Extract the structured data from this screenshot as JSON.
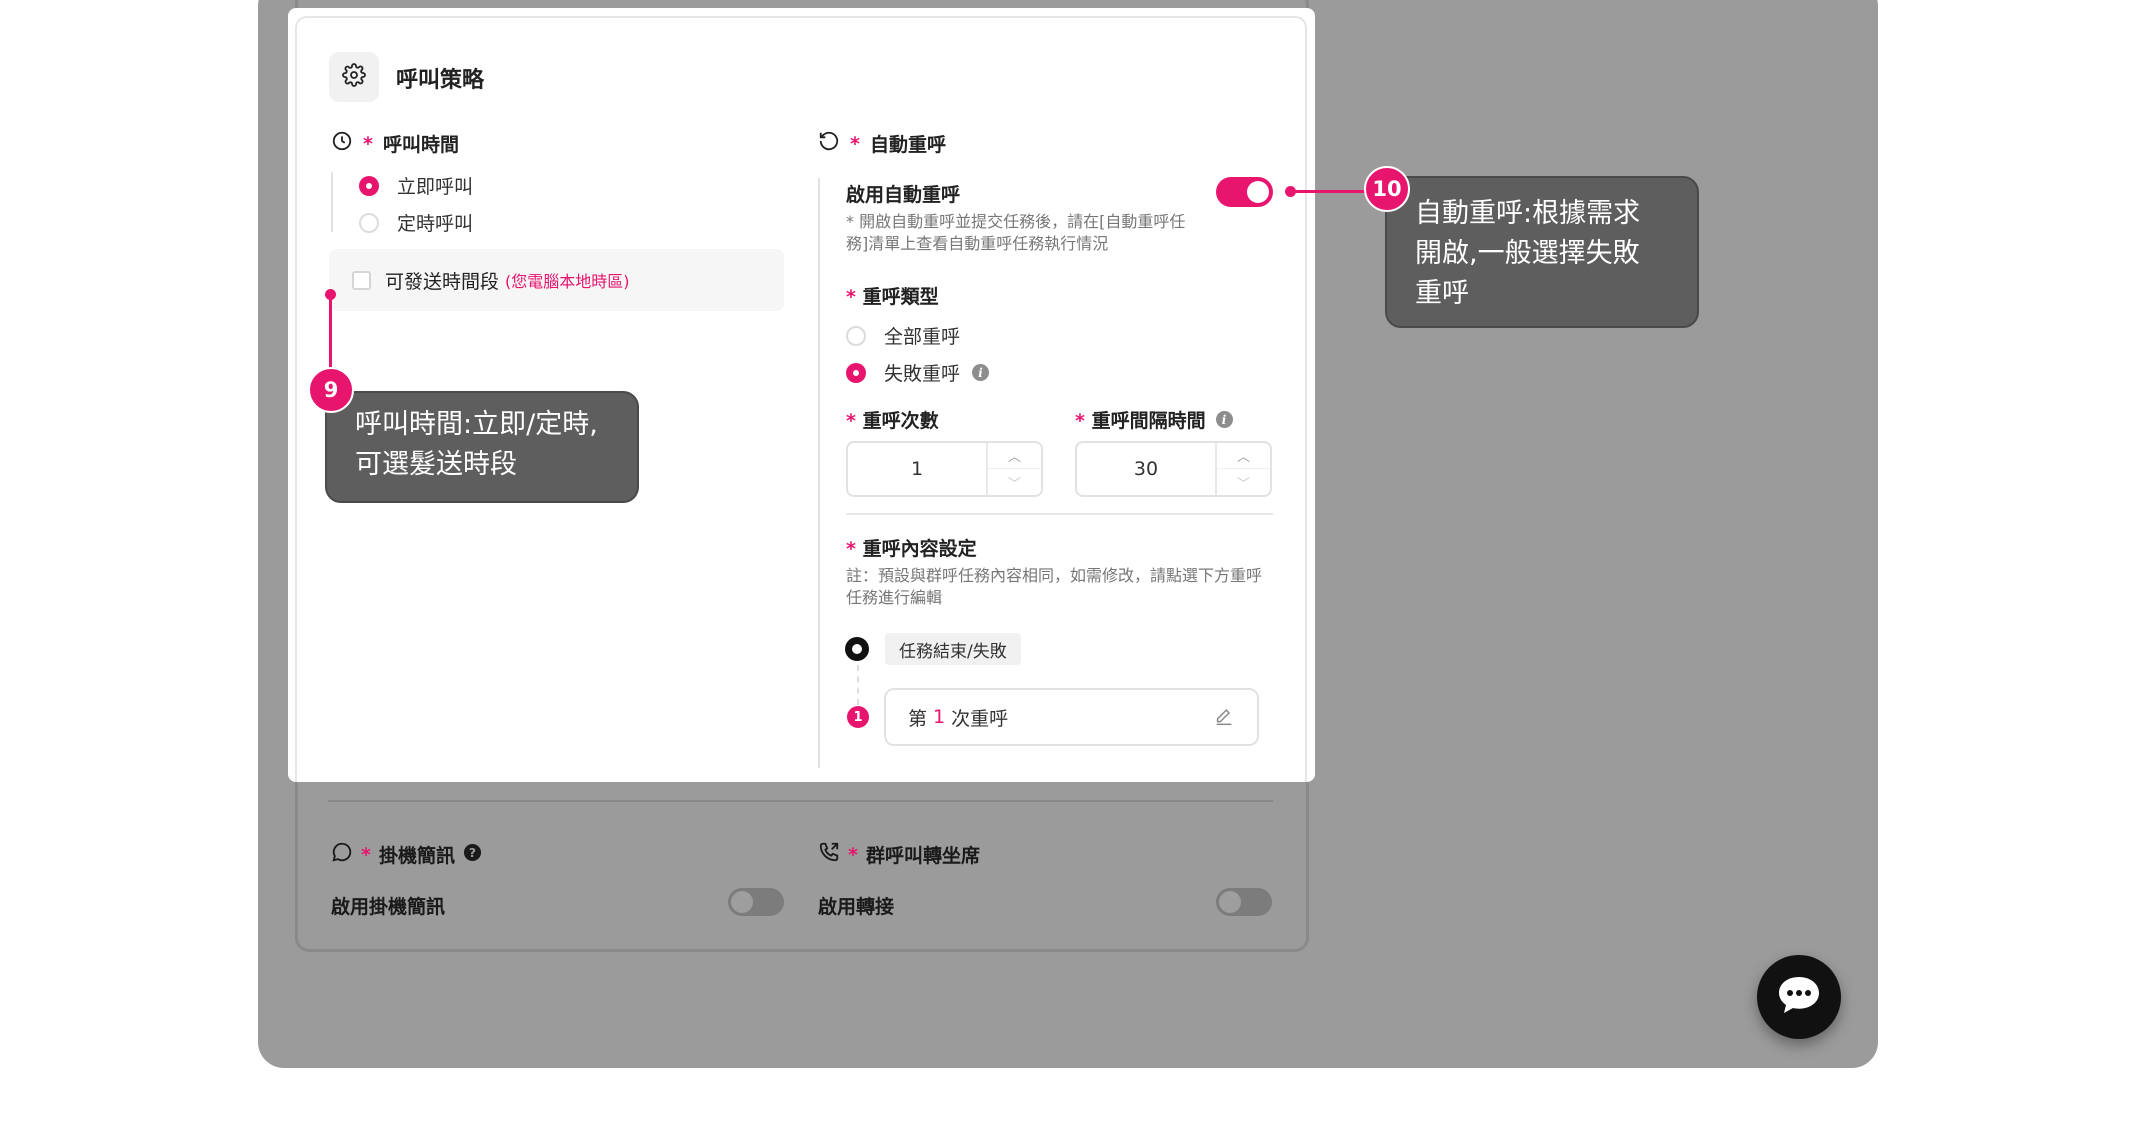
{
  "card": {
    "title": "呼叫策略"
  },
  "call_time": {
    "title": "呼叫時間",
    "required": "*",
    "options": [
      "立即呼叫",
      "定時呼叫"
    ],
    "selected": "立即呼叫",
    "window_label": "可發送時間段",
    "window_note": "(您電腦本地時區)"
  },
  "auto_retry": {
    "title": "自動重呼",
    "required": "*",
    "enable_label": "啟用自動重呼",
    "enabled": true,
    "enable_hint": "* 開啟自動重呼並提交任務後，請在[自動重呼任務]清單上查看自動重呼任務執行情況",
    "type_label": "重呼類型",
    "type_options": [
      "全部重呼",
      "失敗重呼"
    ],
    "type_selected": "失敗重呼",
    "count_label": "重呼次數",
    "count_value": "1",
    "interval_label": "重呼間隔時間",
    "interval_value": "30",
    "content_label": "重呼內容設定",
    "content_hint": "註：預設與群呼任務內容相同，如需修改，請點選下方重呼任務進行編輯",
    "end_tag": "任務結束/失敗",
    "retry_item": {
      "prefix": "第",
      "num": "1",
      "suffix": "次重呼"
    },
    "retry_badge": "1"
  },
  "hangup_sms": {
    "title": "掛機簡訊",
    "required": "*",
    "enable_label": "啟用掛機簡訊",
    "enabled": false
  },
  "transfer": {
    "title": "群呼叫轉坐席",
    "required": "*",
    "enable_label": "啟用轉接",
    "enabled": false
  },
  "callouts": {
    "c9": {
      "badge": "9",
      "line1": "呼叫時間:立即/定時,",
      "line2": "可選髮送時段"
    },
    "c10": {
      "badge": "10",
      "line1": "自動重呼:根據需求",
      "line2": "開啟,一般選擇失敗",
      "line3": "重呼"
    }
  },
  "colors": {
    "accent": "#e8156e",
    "overlay": "#9b9b9b",
    "callout": "#5e5e5e"
  }
}
